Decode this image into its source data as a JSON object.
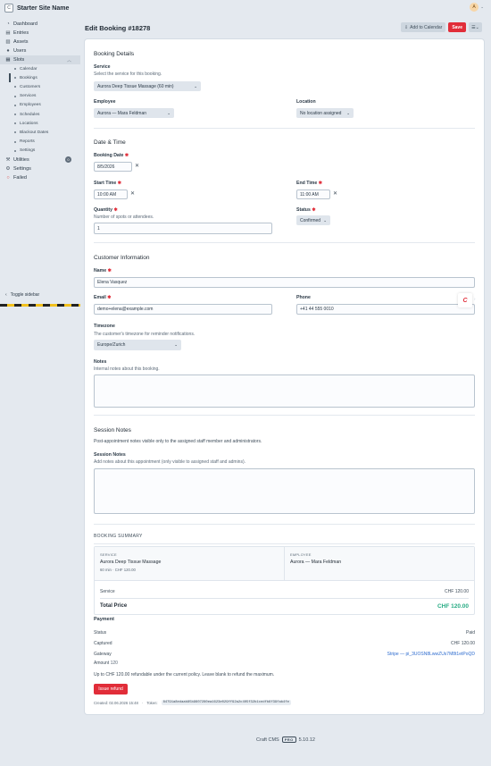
{
  "site": {
    "logo_letter": "C",
    "name": "Starter Site Name"
  },
  "user": {
    "initial": "A"
  },
  "nav": {
    "items": [
      {
        "label": "Dashboard",
        "icon": "dashboard-icon"
      },
      {
        "label": "Entries",
        "icon": "entries-icon"
      },
      {
        "label": "Assets",
        "icon": "assets-icon"
      },
      {
        "label": "Users",
        "icon": "users-icon"
      },
      {
        "label": "Slots",
        "icon": "slots-icon"
      }
    ],
    "slots_sub": [
      "Calendar",
      "Bookings",
      "Customers",
      "Services",
      "Employees",
      "Schedules",
      "Locations",
      "Blackout Dates",
      "Reports",
      "Settings"
    ],
    "utilities": "Utilities",
    "utilities_badge": "0",
    "settings": "Settings",
    "failed": "Failed",
    "toggle_sidebar": "Toggle sidebar"
  },
  "header": {
    "title": "Edit Booking #18278",
    "add_to_calendar": "Add to Calendar",
    "save": "Save"
  },
  "booking_details": {
    "heading": "Booking Details",
    "service_label": "Service",
    "service_hint": "Select the service for this booking.",
    "service_value": "Aurora Deep Tissue Massage (60 min)",
    "employee_label": "Employee",
    "employee_value": "Aurora — Mara Feldman",
    "location_label": "Location",
    "location_value": "No location assigned"
  },
  "date_time": {
    "heading": "Date & Time",
    "booking_date_label": "Booking Date",
    "booking_date_value": "8/5/2026",
    "start_time_label": "Start Time",
    "start_time_value": "10:00 AM",
    "end_time_label": "End Time",
    "end_time_value": "11:00 AM",
    "quantity_label": "Quantity",
    "quantity_hint": "Number of spots or attendees.",
    "quantity_value": "1",
    "status_label": "Status",
    "status_value": "Confirmed"
  },
  "customer": {
    "heading": "Customer Information",
    "name_label": "Name",
    "name_value": "Elena Vasquez",
    "email_label": "Email",
    "email_value": "demo+elena@example.com",
    "phone_label": "Phone",
    "phone_value": "+41 44 555 0010",
    "timezone_label": "Timezone",
    "timezone_hint": "The customer's timezone for reminder notifications.",
    "timezone_value": "Europe/Zurich",
    "notes_label": "Notes",
    "notes_hint": "Internal notes about this booking."
  },
  "session_notes": {
    "heading": "Session Notes",
    "description": "Post-appointment notes visible only to the assigned staff member and administrators.",
    "field_label": "Session Notes",
    "field_hint": "Add notes about this appointment (only visible to assigned staff and admins)."
  },
  "summary": {
    "heading": "BOOKING SUMMARY",
    "service_lbl": "SERVICE",
    "service_name": "Aurora Deep Tissue Massage",
    "service_meta": "60 min · CHF 120.00",
    "employee_lbl": "EMPLOYEE",
    "employee_name": "Aurora — Mara Feldman",
    "line_label": "Service",
    "line_value": "CHF 120.00",
    "total_label": "Total Price",
    "total_value": "CHF 120.00"
  },
  "payment": {
    "heading": "Payment",
    "status_label": "Status",
    "status_value": "Paid",
    "captured_label": "Captured",
    "captured_value": "CHF 120.00",
    "gateway_label": "Gateway",
    "gateway_value": "Stripe — pi_3UOSN8LwwZUs7M8t1etPoQD",
    "amount_label": "Amount",
    "amount_value": "120",
    "refund_note": "Up to CHF 120.00 refundable under the current policy. Leave blank to refund the maximum.",
    "issue_refund": "Issue refund",
    "created": "Created: 02.06.2026 15:48",
    "token_label": "Token:",
    "token_value": "84791a8edaab85b9607280ea1623e029ff92a2c405f32b1cedfb6f39fab4fe"
  },
  "footer": {
    "product": "Craft CMS",
    "edition": "PRO",
    "version": "5.10.12"
  },
  "colors": {
    "accent_red": "#e12d39",
    "total_green": "#27ab83"
  }
}
